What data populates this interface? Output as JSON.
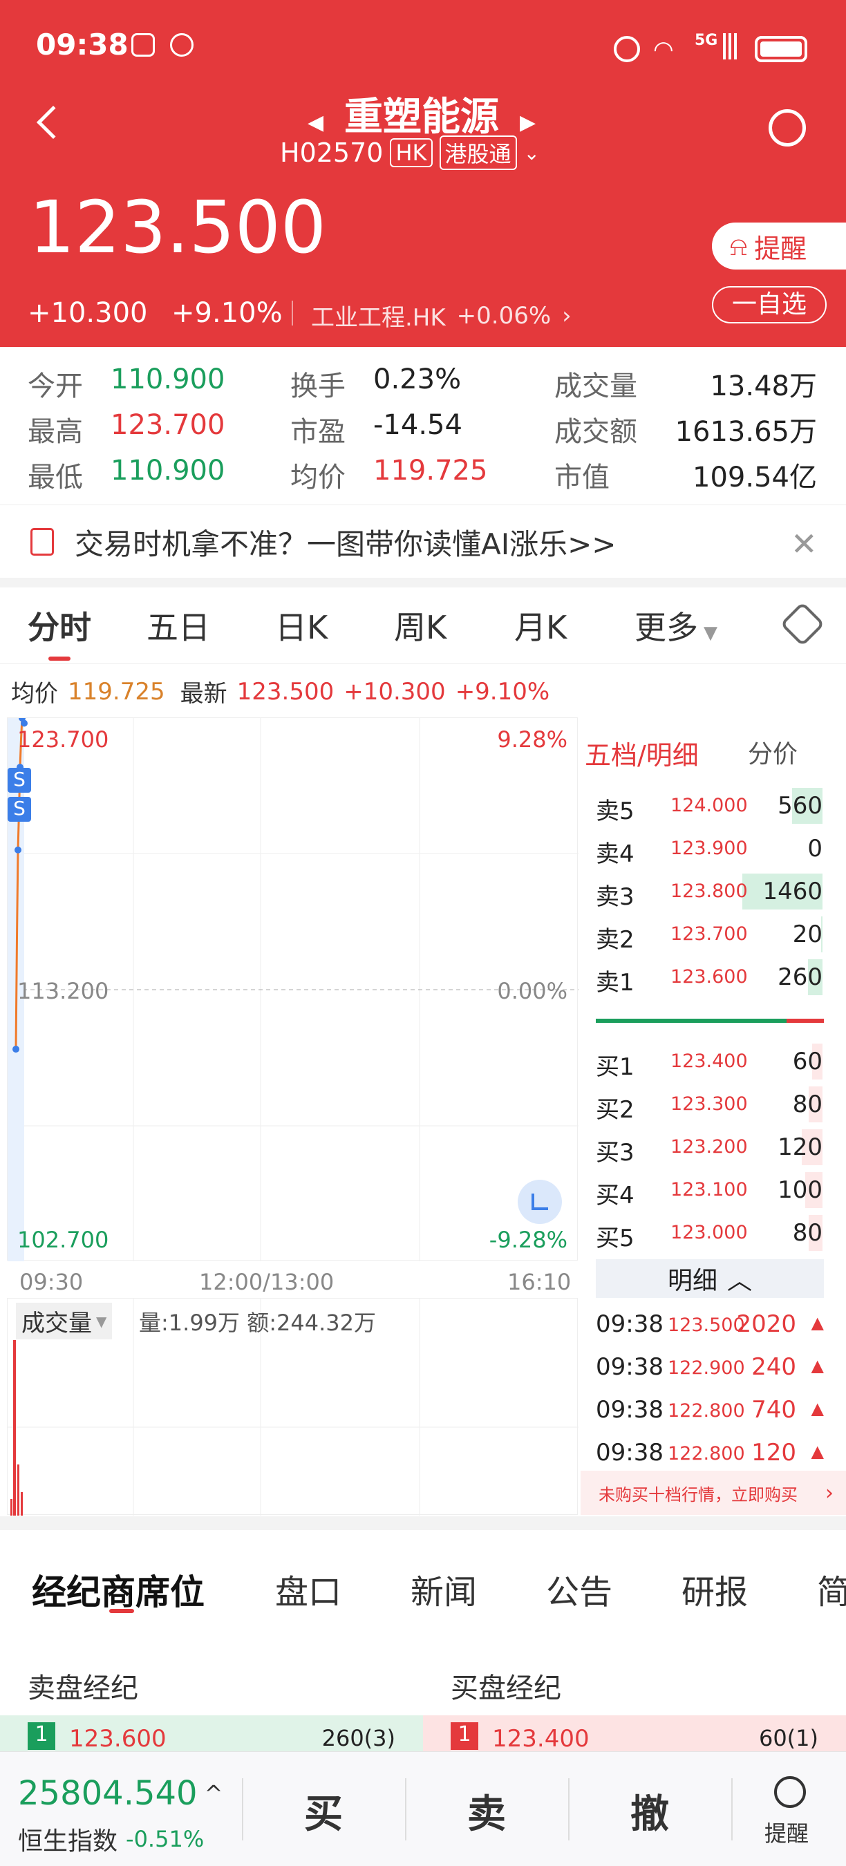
{
  "status": {
    "time": "09:38",
    "network": "5G"
  },
  "header": {
    "name": "重塑能源",
    "code": "H02570",
    "market_tag": "HK",
    "connect_tag": "港股通",
    "price": "123.500",
    "change": "+10.300",
    "change_pct": "+9.10%",
    "sector": "工业工程.HK",
    "sector_change": "+0.06%",
    "remind": "提醒",
    "watch": "一自选"
  },
  "quote": {
    "open_label": "今开",
    "open": "110.900",
    "high_label": "最高",
    "high": "123.700",
    "low_label": "最低",
    "low": "110.900",
    "turnover_label": "换手",
    "turnover": "0.23%",
    "pe_label": "市盈",
    "pe": "-14.54",
    "avg_label": "均价",
    "avg": "119.725",
    "vol_label": "成交量",
    "vol": "13.48万",
    "amt_label": "成交额",
    "amt": "1613.65万",
    "mcap_label": "市值",
    "mcap": "109.54亿"
  },
  "banner": {
    "text": "交易时机拿不准？一图带你读懂AI涨乐>>"
  },
  "tabs": [
    "分时",
    "五日",
    "日K",
    "周K",
    "月K",
    "更多"
  ],
  "info": {
    "avg_label": "均价",
    "avg": "119.725",
    "last_label": "最新",
    "last": "123.500",
    "change": "+10.300",
    "pct": "+9.10%"
  },
  "chart": {
    "top_price": "123.700",
    "mid_price": "113.200",
    "low_price": "102.700",
    "top_pct": "9.28%",
    "mid_pct": "0.00%",
    "low_pct": "-9.28%",
    "t_start": "09:30",
    "t_mid": "12:00/13:00",
    "t_end": "16:10",
    "vol_label": "成交量",
    "vol_info": "量:1.99万 额:244.32万",
    "s_marker": "S"
  },
  "chart_data": {
    "type": "line",
    "x": [
      "09:30",
      "09:31",
      "09:32",
      "09:33",
      "09:34",
      "09:35",
      "09:36",
      "09:37",
      "09:38"
    ],
    "series": [
      {
        "values": [
          110.9,
          115.2,
          118.6,
          120.1,
          121.8,
          122.9,
          123.7,
          123.6,
          123.5
        ]
      }
    ],
    "ylim": [
      102.7,
      123.7
    ]
  },
  "orderbook": {
    "title": "五档/明细",
    "tab2": "分价",
    "asks": [
      {
        "n": "卖5",
        "p": "124.000",
        "v": "560"
      },
      {
        "n": "卖4",
        "p": "123.900",
        "v": "0"
      },
      {
        "n": "卖3",
        "p": "123.800",
        "v": "1460"
      },
      {
        "n": "卖2",
        "p": "123.700",
        "v": "20"
      },
      {
        "n": "卖1",
        "p": "123.600",
        "v": "260"
      }
    ],
    "bids": [
      {
        "n": "买1",
        "p": "123.400",
        "v": "60"
      },
      {
        "n": "买2",
        "p": "123.300",
        "v": "80"
      },
      {
        "n": "买3",
        "p": "123.200",
        "v": "120"
      },
      {
        "n": "买4",
        "p": "123.100",
        "v": "100"
      },
      {
        "n": "买5",
        "p": "123.000",
        "v": "80"
      }
    ],
    "detail_label": "明细",
    "trades": [
      {
        "t": "09:38",
        "p": "123.500",
        "v": "2020"
      },
      {
        "t": "09:38",
        "p": "122.900",
        "v": "240"
      },
      {
        "t": "09:38",
        "p": "122.800",
        "v": "740"
      },
      {
        "t": "09:38",
        "p": "122.800",
        "v": "120"
      }
    ],
    "promo": "未购买十档行情，立即购买"
  },
  "section_tabs": [
    "经纪商席位",
    "盘口",
    "新闻",
    "公告",
    "研报",
    "简"
  ],
  "broker": {
    "sell_label": "卖盘经纪",
    "buy_label": "买盘经纪",
    "sell_rank": "1",
    "sell_price": "123.600",
    "sell_vol": "260(3)",
    "buy_rank": "1",
    "buy_price": "123.400",
    "buy_vol": "60(1)"
  },
  "bottom": {
    "index_value": "25804.540",
    "index_name": "恒生指数",
    "index_pct": "-0.51%",
    "buy": "买",
    "sell": "卖",
    "cancel": "撤",
    "remind": "提醒"
  }
}
